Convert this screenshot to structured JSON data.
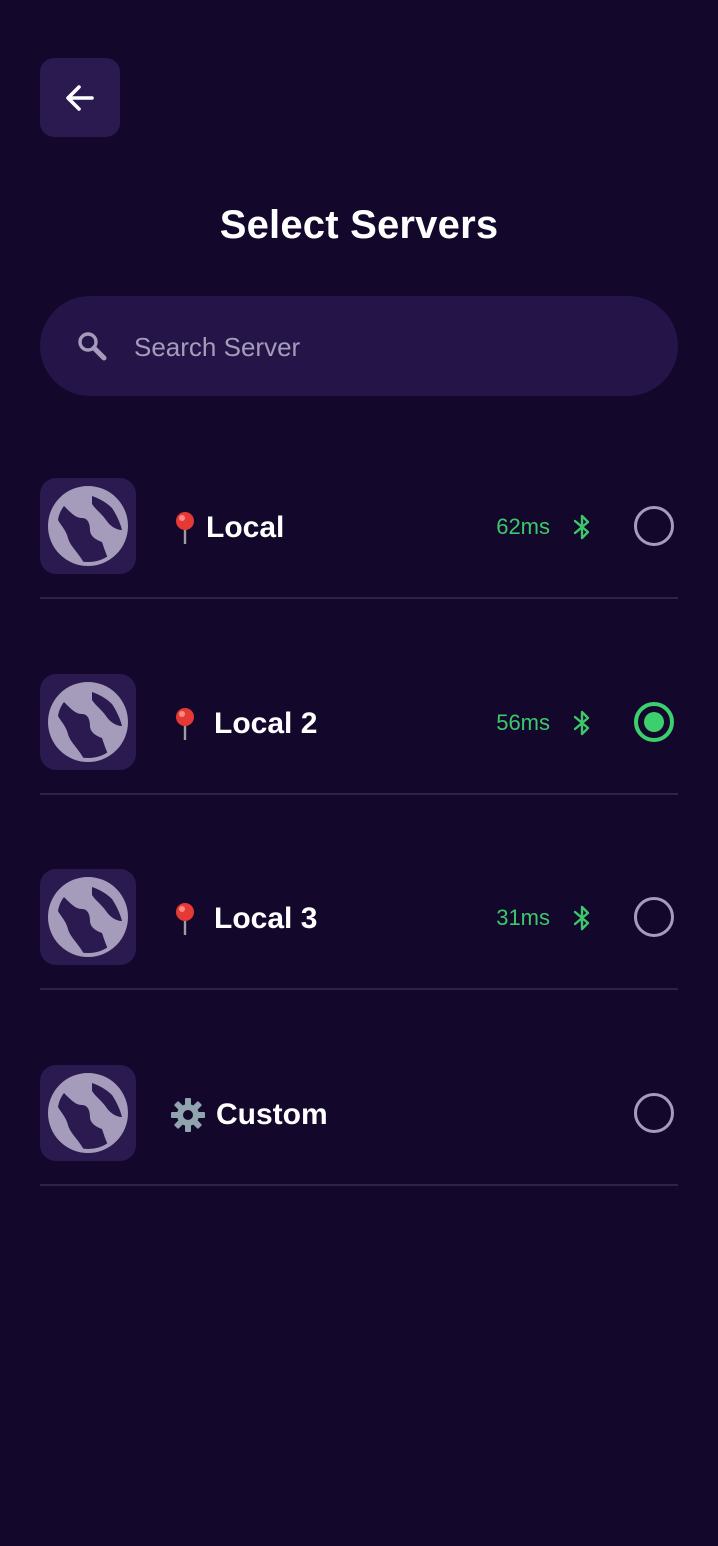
{
  "header": {
    "back_label": "Back",
    "title": "Select Servers"
  },
  "search": {
    "placeholder": "Search Server",
    "value": ""
  },
  "servers": [
    {
      "name": "Local",
      "emoji": "pin",
      "ping": "62ms",
      "selected": false
    },
    {
      "name": "Local 2",
      "emoji": "pin",
      "ping": "56ms",
      "selected": true
    },
    {
      "name": "Local 3",
      "emoji": "pin",
      "ping": "31ms",
      "selected": false
    },
    {
      "name": "Custom",
      "emoji": "gear",
      "ping": "",
      "selected": false
    }
  ],
  "colors": {
    "background": "#13072c",
    "surface": "#2a1a4f",
    "search_bg": "#241448",
    "accent_green": "#3ccf6e",
    "muted": "#a49cba"
  },
  "icons": {
    "back": "arrow-left-icon",
    "search": "search-icon",
    "server": "globe-icon",
    "pin": "map-pin-icon",
    "gear": "gear-icon",
    "signal": "bluetooth-icon"
  }
}
